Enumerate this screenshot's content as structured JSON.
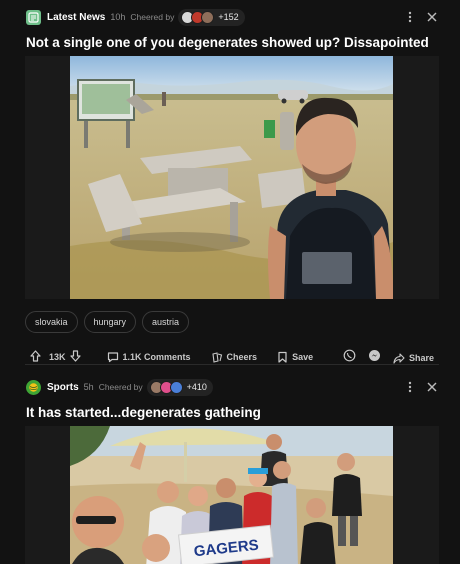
{
  "posts": [
    {
      "community": "Latest News",
      "age": "10h",
      "cheered_label": "Cheered by",
      "cheer_count": "+152",
      "title": "Not a single one of you degenerates showed up? Dissapointed",
      "tags": [
        "slovakia",
        "hungary",
        "austria"
      ],
      "upvotes": "13K",
      "comments": "1.1K Comments",
      "cheers": "Cheers",
      "save": "Save",
      "share": "Share",
      "icon_color": "#6fbf8a"
    },
    {
      "community": "Sports",
      "age": "5h",
      "cheered_label": "Cheered by",
      "cheer_count": "+410",
      "title": "It has started...degenerates gatheing",
      "sign_text": "GAGERS",
      "icon_color": "#3fa535"
    }
  ],
  "colors": {
    "background": "#121212",
    "text": "#e8e8e8",
    "muted": "#8a8a8a"
  }
}
